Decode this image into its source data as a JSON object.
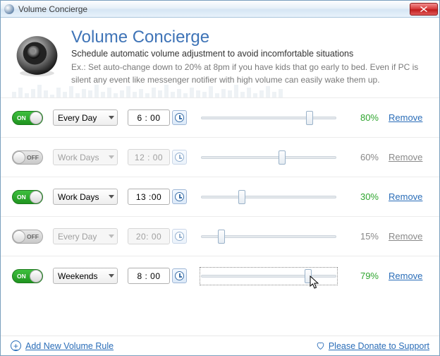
{
  "window": {
    "title": "Volume Concierge"
  },
  "header": {
    "title": "Volume Concierge",
    "subtitle": "Schedule automatic volume adjustment to avoid incomfortable situations",
    "example": "Ex.: Set auto-change down to 20% at 8pm if you have kids that go early to bed. Even if PC is silent any event like messenger notifier with high volume can easily wake them up."
  },
  "toggle_labels": {
    "on": "ON",
    "off": "OFF"
  },
  "rules": [
    {
      "enabled": true,
      "day": "Every Day",
      "time": "6 : 00",
      "percent": 80,
      "percent_label": "80%",
      "focused": false
    },
    {
      "enabled": false,
      "day": "Work Days",
      "time": "12 : 00",
      "percent": 60,
      "percent_label": "60%",
      "focused": false
    },
    {
      "enabled": true,
      "day": "Work Days",
      "time": "13 :00",
      "percent": 30,
      "percent_label": "30%",
      "focused": false
    },
    {
      "enabled": false,
      "day": "Every Day",
      "time": "20: 00",
      "percent": 15,
      "percent_label": "15%",
      "focused": false
    },
    {
      "enabled": true,
      "day": "Weekends",
      "time": "8 : 00",
      "percent": 79,
      "percent_label": "79%",
      "focused": true
    }
  ],
  "actions": {
    "remove": "Remove",
    "add_rule": "Add New Volume Rule",
    "donate": "Please Donate to Support"
  },
  "eq_bars": [
    8,
    14,
    6,
    12,
    18,
    10,
    4,
    14,
    8,
    16,
    6,
    12,
    10,
    18,
    8,
    14,
    6,
    10,
    16,
    8,
    12,
    6,
    14,
    10,
    18,
    8,
    12,
    6,
    14,
    10,
    8,
    16,
    6,
    12,
    10,
    18,
    8,
    14,
    6,
    10,
    16,
    8,
    12
  ]
}
